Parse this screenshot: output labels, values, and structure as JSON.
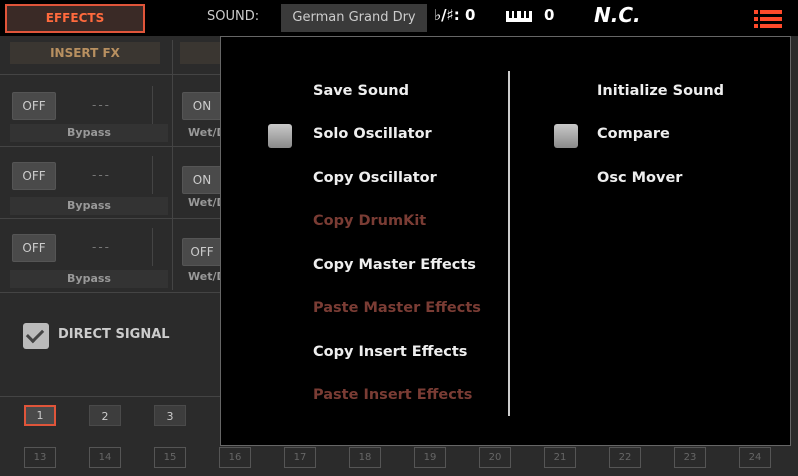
{
  "header": {
    "effects_tab": "EFFECTS",
    "sound_label": "SOUND:",
    "sound_name": "German Grand Dry",
    "transpose": "♭/♯:  0",
    "octave": "0",
    "chord": "N.C.",
    "accent_color": "#ff4a2a"
  },
  "left": {
    "insert_tab": "INSERT FX",
    "rows": [
      {
        "btn": "OFF",
        "value": "---",
        "label": "Bypass",
        "btn2": "ON",
        "label2": "Wet/D"
      },
      {
        "btn": "OFF",
        "value": "---",
        "label": "Bypass",
        "btn2": "ON",
        "label2": "Wet/D"
      },
      {
        "btn": "OFF",
        "value": "---",
        "label": "Bypass",
        "btn2": "OFF",
        "label2": "Wet/D"
      }
    ],
    "direct_signal": "DIRECT SIGNAL",
    "numbers_row1": [
      "1",
      "2",
      "3"
    ],
    "numbers_row2": [
      "13",
      "14",
      "15",
      "16",
      "17",
      "18",
      "19",
      "20",
      "21",
      "22",
      "23",
      "24"
    ]
  },
  "menu": {
    "col1": [
      {
        "label": "Save Sound"
      },
      {
        "label": "Solo Oscillator"
      },
      {
        "label": "Copy Oscillator"
      },
      {
        "label": "Copy DrumKit"
      },
      {
        "label": "Copy Master Effects"
      },
      {
        "label": "Paste Master Effects"
      },
      {
        "label": "Copy Insert Effects"
      },
      {
        "label": "Paste Insert Effects"
      }
    ],
    "col2": [
      {
        "label": "Initialize Sound"
      },
      {
        "label": "Compare"
      },
      {
        "label": "Osc Mover"
      }
    ]
  }
}
